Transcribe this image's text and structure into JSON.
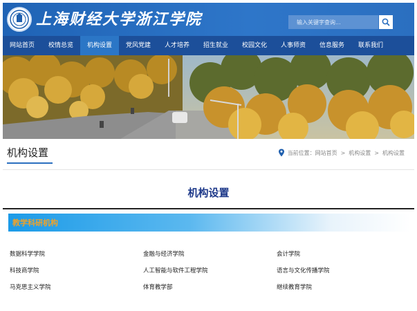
{
  "header": {
    "title": "上海财经大学浙江学院",
    "search_placeholder": "输入关键字查询...",
    "logo_icon": "university-seal-icon",
    "search_icon": "search-icon"
  },
  "nav": {
    "items": [
      {
        "label": "网站首页",
        "active": false
      },
      {
        "label": "校情总览",
        "active": false
      },
      {
        "label": "机构设置",
        "active": true
      },
      {
        "label": "党风党建",
        "active": false
      },
      {
        "label": "人才培养",
        "active": false
      },
      {
        "label": "招生就业",
        "active": false
      },
      {
        "label": "校园文化",
        "active": false
      },
      {
        "label": "人事师资",
        "active": false
      },
      {
        "label": "信息服务",
        "active": false
      },
      {
        "label": "联系我们",
        "active": false
      }
    ]
  },
  "title_bar": {
    "heading": "机构设置",
    "breadcrumb": {
      "prefix": "当前位置：",
      "items": [
        "网站首页",
        "机构设置",
        "机构设置"
      ],
      "separator": ">",
      "icon": "location-pin-icon"
    }
  },
  "content": {
    "title": "机构设置",
    "section_label": "教学科研机构",
    "departments": [
      "数据科学学院",
      "金融与经济学院",
      "会计学院",
      "科技商学院",
      "人工智能与软件工程学院",
      "语言与文化传播学院",
      "马克思主义学院",
      "体育教学部",
      "继续教育学院"
    ]
  },
  "colors": {
    "header_blue": "#2b6fc0",
    "nav_blue": "#1c4f9a",
    "nav_active": "#2b76c6",
    "content_title": "#1f3a8a",
    "section_label": "#f0a22a"
  }
}
